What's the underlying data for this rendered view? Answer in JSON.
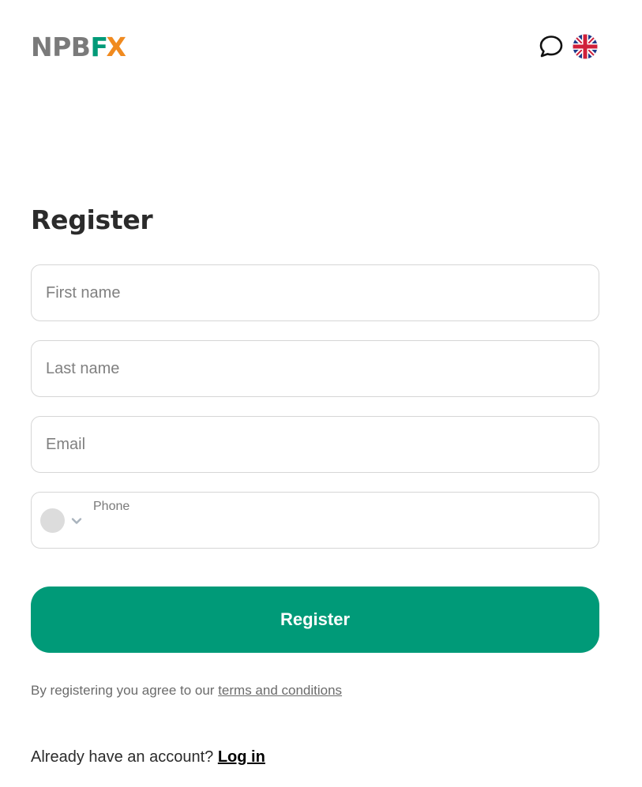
{
  "header": {
    "logo": {
      "part1": "NPB",
      "part2": "F",
      "part3": "X"
    },
    "icons": {
      "chat": "chat-bubble-icon",
      "language": "uk-flag-icon"
    }
  },
  "page": {
    "title": "Register"
  },
  "form": {
    "first_name": {
      "placeholder": "First name",
      "value": ""
    },
    "last_name": {
      "placeholder": "Last name",
      "value": ""
    },
    "email": {
      "placeholder": "Email",
      "value": ""
    },
    "phone": {
      "label": "Phone",
      "value": ""
    },
    "submit_label": "Register"
  },
  "terms": {
    "text": "By registering you agree to our ",
    "link": "terms and conditions"
  },
  "login": {
    "text": "Already have an account? ",
    "link": "Log in"
  },
  "colors": {
    "brand_green": "#009a78",
    "brand_orange": "#f08a1f",
    "logo_gray": "#7a7a7a",
    "border": "#d6d6d6"
  }
}
